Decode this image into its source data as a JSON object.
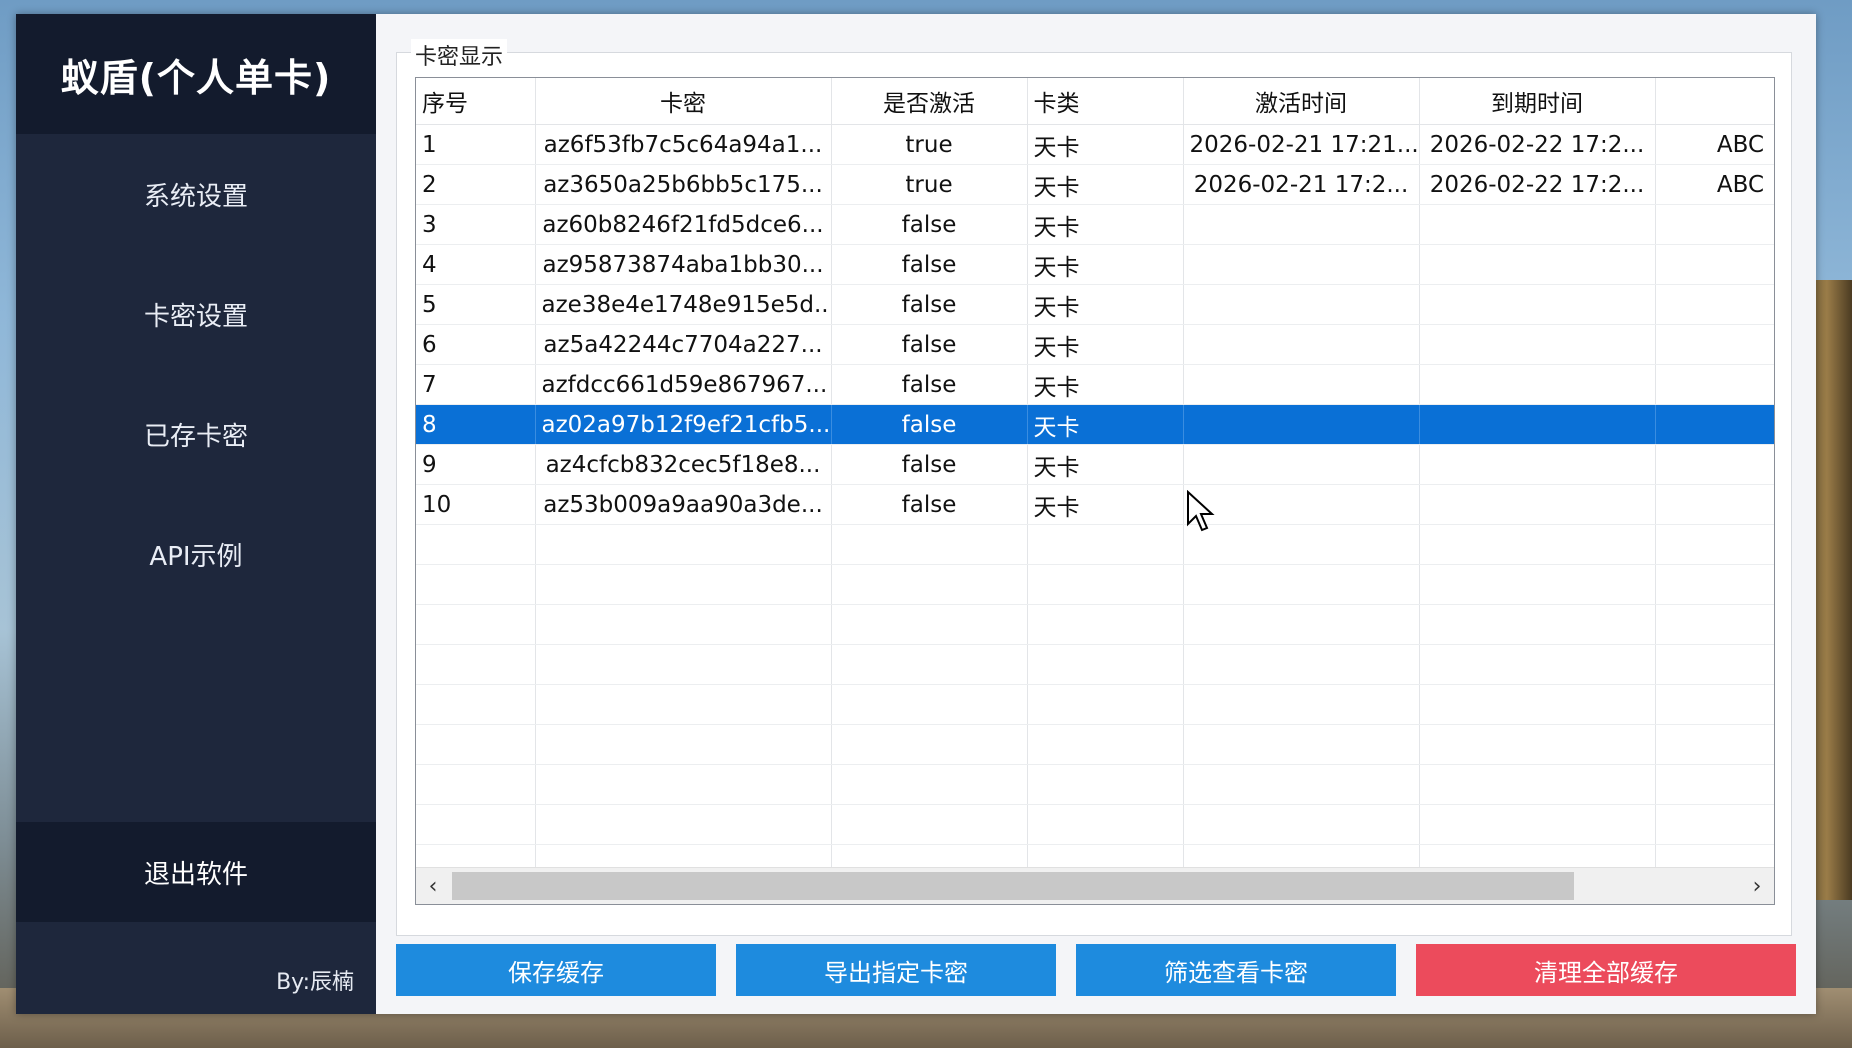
{
  "sidebar": {
    "brand": "蚁盾(个人单卡)",
    "items": [
      "系统设置",
      "卡密设置",
      "已存卡密",
      "API示例"
    ],
    "exit_label": "退出软件",
    "author": "By:辰楠"
  },
  "group_title": "卡密显示",
  "table": {
    "columns": [
      "序号",
      "卡密",
      "是否激活",
      "卡类",
      "激活时间",
      "到期时间",
      ""
    ],
    "rows": [
      [
        "1",
        "az6f53fb7c5c64a94a1...",
        "true",
        "天卡",
        "2026-02-21 17:21...",
        "2026-02-22 17:2...",
        "ABC"
      ],
      [
        "2",
        "az3650a25b6bb5c175...",
        "true",
        "天卡",
        "2026-02-21 17:2...",
        "2026-02-22 17:2...",
        "ABC"
      ],
      [
        "3",
        "az60b8246f21fd5dce6...",
        "false",
        "天卡",
        "",
        "",
        ""
      ],
      [
        "4",
        "az95873874aba1bb30...",
        "false",
        "天卡",
        "",
        "",
        ""
      ],
      [
        "5",
        "aze38e4e1748e915e5d...",
        "false",
        "天卡",
        "",
        "",
        ""
      ],
      [
        "6",
        "az5a42244c7704a227...",
        "false",
        "天卡",
        "",
        "",
        ""
      ],
      [
        "7",
        "azfdcc661d59e867967...",
        "false",
        "天卡",
        "",
        "",
        ""
      ],
      [
        "8",
        "az02a97b12f9ef21cfb5...",
        "false",
        "天卡",
        "",
        "",
        ""
      ],
      [
        "9",
        "az4cfcb832cec5f18e8...",
        "false",
        "天卡",
        "",
        "",
        ""
      ],
      [
        "10",
        "az53b009a9aa90a3de...",
        "false",
        "天卡",
        "",
        "",
        ""
      ]
    ],
    "selected_row": 8,
    "empty_rows": 9
  },
  "scroll": {
    "left_icon": "chevron-left-icon",
    "right_icon": "chevron-right-icon"
  },
  "buttons": {
    "save_cache": "保存缓存",
    "export_cards": "导出指定卡密",
    "filter_cards": "筛选查看卡密",
    "clear_cache": "清理全部缓存"
  },
  "colors": {
    "sidebar": "#1e273c",
    "sidebar_dark": "#131b2d",
    "primary": "#1e8bde",
    "danger": "#ec4b5c",
    "selection": "#0a70d6"
  }
}
